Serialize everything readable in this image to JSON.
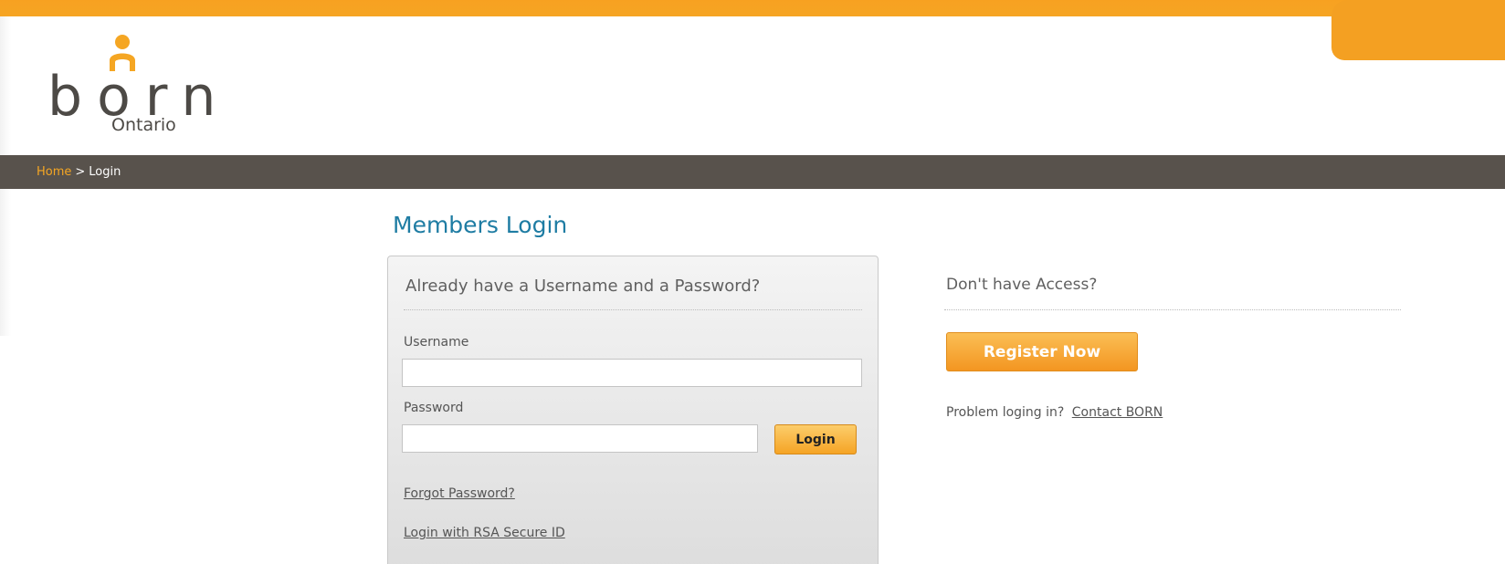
{
  "brand": {
    "logo_word": "born",
    "logo_sub": "Ontario",
    "accent_color": "#f5a623",
    "title_color": "#1e7ca3"
  },
  "breadcrumb": {
    "home": "Home",
    "separator": ">",
    "current": "Login"
  },
  "page_title": "Members Login",
  "login_panel": {
    "heading": "Already have a Username and a Password?",
    "username_label": "Username",
    "username_value": "",
    "password_label": "Password",
    "password_value": "",
    "login_button": "Login",
    "forgot_link": "Forgot Password?",
    "rsa_link": "Login with RSA Secure ID"
  },
  "register_panel": {
    "heading": "Don't have Access?",
    "register_button": "Register Now",
    "problem_text": "Problem loging in?",
    "contact_link": "Contact BORN"
  }
}
